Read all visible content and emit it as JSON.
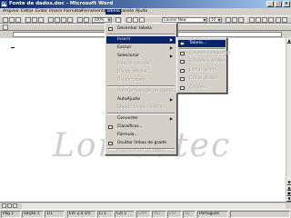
{
  "window": {
    "title": "Fonte de dados.doc - Microsoft Word"
  },
  "menubar": {
    "items": [
      {
        "label": "Arquivo"
      },
      {
        "label": "Editar"
      },
      {
        "label": "Exibir"
      },
      {
        "label": "Inserir"
      },
      {
        "label": "Formatar"
      },
      {
        "label": "Ferramentas"
      },
      {
        "label": "Tabela"
      },
      {
        "label": "Janela"
      },
      {
        "label": "Ajuda"
      }
    ],
    "active": "Tabela"
  },
  "toolbar": {
    "zoom": "100%",
    "font": "Courier New",
    "size": "10"
  },
  "table_menu": {
    "items": [
      {
        "label": "Desenhar tabela",
        "state": "normal"
      },
      {
        "label": "Inserir",
        "state": "selected",
        "submenu": true
      },
      {
        "label": "Excluir",
        "state": "normal",
        "submenu": true
      },
      {
        "label": "Selecionar",
        "state": "normal",
        "submenu": true
      },
      {
        "label": "Mesclar células",
        "state": "disabled"
      },
      {
        "label": "Dividir células...",
        "state": "disabled"
      },
      {
        "label": "Dividir tabela",
        "state": "disabled"
      },
      {
        "label": "AutoFormatação da tabela...",
        "state": "disabled"
      },
      {
        "label": "AutoAjuste",
        "state": "normal",
        "submenu": true
      },
      {
        "label": "Repetir linhas de título",
        "state": "disabled"
      },
      {
        "label": "Converter",
        "state": "normal",
        "submenu": true
      },
      {
        "label": "Classificar...",
        "state": "normal"
      },
      {
        "label": "Fórmula...",
        "state": "normal"
      },
      {
        "label": "Ocultar linhas de grade",
        "state": "normal"
      },
      {
        "label": "Propriedades da tabela...",
        "state": "disabled"
      }
    ]
  },
  "insert_submenu": {
    "items": [
      {
        "label": "Tabela...",
        "state": "selected"
      },
      {
        "label": "Colunas à esquerda",
        "state": "disabled"
      },
      {
        "label": "Colunas à direita",
        "state": "disabled"
      },
      {
        "label": "Linhas acima",
        "state": "disabled"
      },
      {
        "label": "Linhas abaixo",
        "state": "disabled"
      },
      {
        "label": "Células...",
        "state": "disabled"
      }
    ]
  },
  "watermark": "Lomeutec",
  "statusbar": {
    "page": "Pág 1",
    "section": "Seção 1",
    "pages": "1/1",
    "position": "Em 2,4 cm",
    "line": "Li 1",
    "column": "Col 1",
    "rec": "GRA",
    "alt": "ALT",
    "ext": "EST",
    "ovr": "SE",
    "language": "Português"
  }
}
